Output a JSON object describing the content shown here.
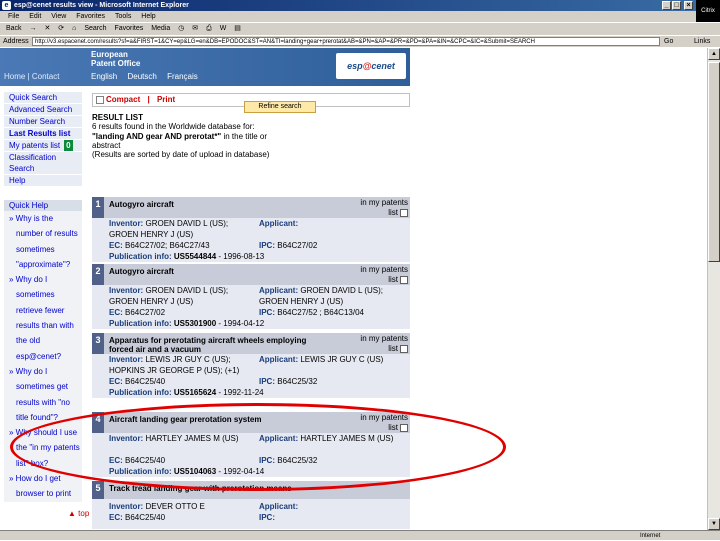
{
  "window": {
    "title": "esp@cenet results view - Microsoft Internet Explorer",
    "minimize": "_",
    "maximize": "□",
    "close": "×",
    "brand": "Citrix"
  },
  "menubar": [
    "File",
    "Edit",
    "View",
    "Favorites",
    "Tools",
    "Help"
  ],
  "toolbar": {
    "back": "Back",
    "forward": "→",
    "stop": "✕",
    "refresh": "⟳",
    "home": "⌂",
    "search": "Search",
    "favorites": "Favorites",
    "media": "Media",
    "history": "◷",
    "mail": "✉",
    "print": "⎙",
    "edit": "W",
    "discuss": "▤"
  },
  "address": {
    "label": "Address",
    "url": "http://v3.espacenet.com/results?sf=a&FIRST=1&CY=ep&LG=en&DB=EPODOC&ST=AN&TI=landing+gear+prerotat&AB=&PN=&AP=&PR=&PD=&PA=&IN=&CPC=&IC=&Submit=SEARCH",
    "go": "Go",
    "links": "Links"
  },
  "epo": {
    "home_link": "Home | Contact",
    "name_line1": "European",
    "name_line2": "Patent Office",
    "languages": [
      "English",
      "Deutsch",
      "Français"
    ],
    "logo_prefix": "esp",
    "logo_at": "@",
    "logo_suffix": "cenet"
  },
  "sidebar": {
    "items": [
      {
        "label": "Quick Search"
      },
      {
        "label": "Advanced Search"
      },
      {
        "label": "Number Search"
      },
      {
        "label": "Last Results list"
      },
      {
        "label": "My patents list"
      },
      {
        "label": "Classification Search"
      },
      {
        "label": "Help"
      }
    ],
    "my_patents_count": "0",
    "quick_help_title": "Quick Help",
    "quick_help": [
      "» Why is the number of results sometimes \"approximate\"?",
      "» Why do I sometimes retrieve fewer results than with the old esp@cenet?",
      "» Why do I sometimes get results with \"no title found\"?",
      "» Why should I use the \"in my patents list\" box?",
      "» How do I get browser to print"
    ],
    "top_link": "▲ top"
  },
  "content_toolbar": {
    "compact": "Compact",
    "separator": "|",
    "print": "Print"
  },
  "result_list": {
    "title": "RESULT LIST",
    "summary": "6 results found in the Worldwide database for:",
    "query": "\"landing AND gear AND prerotat*\"",
    "scope": " in the title or abstract",
    "sort_note": "(Results are sorted by date of upload in database)",
    "refine_button": "Refine search"
  },
  "labels": {
    "inventor": "Inventor:",
    "applicant": "Applicant:",
    "ec": "EC:",
    "ipc": "IPC:",
    "pubinfo": "Publication info:",
    "mypat1": "in my patents",
    "mypat2": "list"
  },
  "results": [
    {
      "num": "1",
      "title": "Autogyro aircraft",
      "inventor": "GROEN DAVID L (US); GROEN HENRY J (US)",
      "applicant": "",
      "ec": "B64C27/02; B64C27/43",
      "ipc": "B64C27/02",
      "pub_number": "US5544844",
      "pub_date": "- 1996-08-13"
    },
    {
      "num": "2",
      "title": "Autogyro aircraft",
      "inventor": "GROEN DAVID L (US); GROEN HENRY J (US)",
      "applicant": "GROEN DAVID L (US); GROEN HENRY J (US)",
      "ec": "B64C27/02",
      "ipc": "B64C27/52 ; B64C13/04",
      "pub_number": "US5301900",
      "pub_date": "- 1994-04-12"
    },
    {
      "num": "3",
      "title": "Apparatus for prerotating aircraft wheels employing forced air and a vacuum",
      "inventor": "LEWIS JR GUY C (US); HOPKINS JR GEORGE P (US); (+1)",
      "applicant": "LEWIS JR GUY C (US)",
      "ec": "B64C25/40",
      "ipc": "B64C25/32",
      "pub_number": "US5165624",
      "pub_date": "- 1992-11-24"
    },
    {
      "num": "4",
      "title": "Aircraft landing gear prerotation system",
      "inventor": "HARTLEY JAMES M (US)",
      "applicant": "HARTLEY JAMES M (US)",
      "ec": "B64C25/40",
      "ipc": "B64C25/32",
      "pub_number": "US5104063",
      "pub_date": "- 1992-04-14"
    },
    {
      "num": "5",
      "title": "Track tread landing gear with prerotation means",
      "inventor": "DEVER OTTO E",
      "applicant": "",
      "ec": "B64C25/40",
      "ipc": "",
      "pub_number": "",
      "pub_date": ""
    }
  ],
  "status": {
    "zone": "Internet"
  }
}
